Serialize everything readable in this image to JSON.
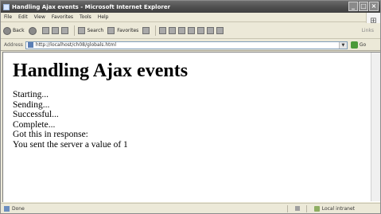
{
  "window": {
    "title": "Handling Ajax events - Microsoft Internet Explorer",
    "controls": {
      "minimize": "_",
      "maximize": "□",
      "close": "×"
    }
  },
  "menubar": {
    "items": [
      "File",
      "Edit",
      "View",
      "Favorites",
      "Tools",
      "Help"
    ]
  },
  "toolbar": {
    "back_label": "Back",
    "search_label": "Search",
    "favorites_label": "Favorites",
    "links_label": "Links"
  },
  "addressbar": {
    "label": "Address",
    "url": "http://localhost/ch08/globals.html",
    "go_label": "Go"
  },
  "page": {
    "heading": "Handling Ajax events",
    "log_lines": [
      "Starting...",
      "Sending...",
      "Successful...",
      "Complete...",
      "Got this in response:",
      "You sent the server a value of 1"
    ]
  },
  "statusbar": {
    "status": "Done",
    "zone": "Local intranet"
  }
}
